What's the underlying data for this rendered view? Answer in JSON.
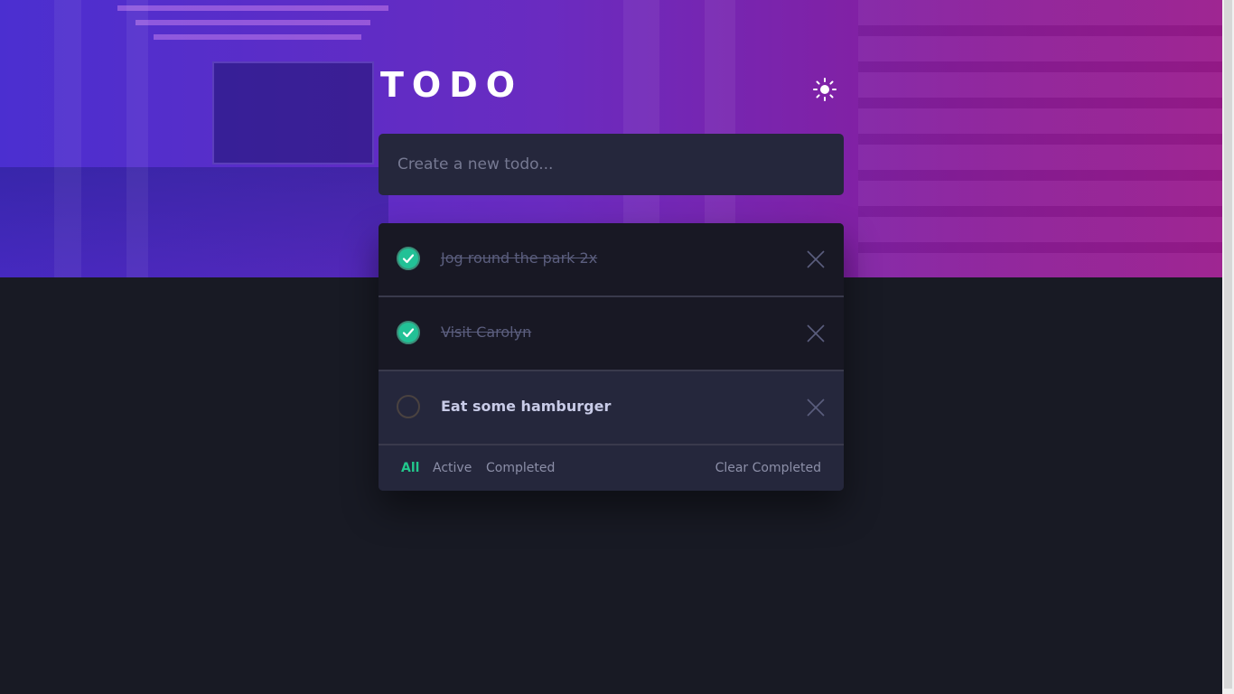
{
  "app": {
    "title": "TODO",
    "theme_icon": "sun-icon"
  },
  "new_todo": {
    "placeholder": "Create a new todo...",
    "value": ""
  },
  "todos": [
    {
      "text": "Jog round the park 2x",
      "completed": true
    },
    {
      "text": "Visit Carolyn",
      "completed": true
    },
    {
      "text": "Eat some hamburger",
      "completed": false
    }
  ],
  "footer": {
    "filters": [
      "All",
      "Active",
      "Completed"
    ],
    "active_filter": "All",
    "clear_label": "Clear Completed"
  },
  "colors": {
    "accent": "#22c78c",
    "check_fill": "#22c196",
    "panel": "#25273c",
    "background": "#181a24"
  }
}
